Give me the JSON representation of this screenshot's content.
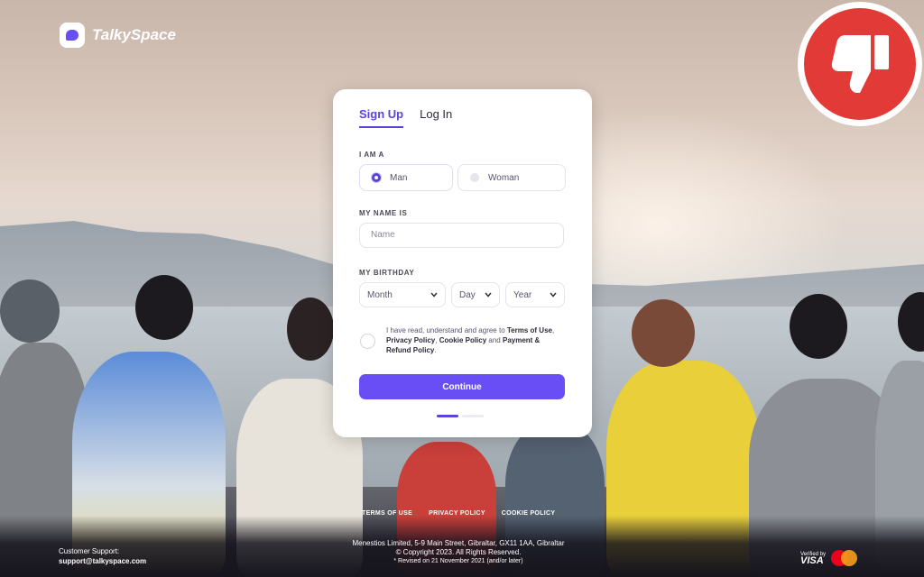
{
  "brand": {
    "name": "TalkySpace"
  },
  "tabs": {
    "signup": "Sign Up",
    "login": "Log In"
  },
  "form": {
    "gender_label": "I AM A",
    "gender_options": {
      "man": "Man",
      "woman": "Woman"
    },
    "selected_gender": "Man",
    "name_label": "MY NAME IS",
    "name_placeholder": "Name",
    "birthday_label": "MY BIRTHDAY",
    "month": "Month",
    "day": "Day",
    "year": "Year",
    "terms": {
      "prefix": "I have read, understand and agree to ",
      "terms_of_use": "Terms of Use",
      "sep1": ", ",
      "privacy": "Privacy Policy",
      "sep2": ", ",
      "cookie": "Cookie Policy",
      "and": " and ",
      "payment": "Payment & Refund Policy",
      "end": "."
    },
    "continue_label": "Continue",
    "progress_step": "1 of 2"
  },
  "footer": {
    "links": {
      "terms": "TERMS OF USE",
      "privacy": "PRIVACY POLICY",
      "cookie": "COOKIE POLICY"
    },
    "support_label": "Customer Support:",
    "support_email": "support@talkyspace.com",
    "address": "Menestios Limited, 5-9 Main Street, Gibraltar, GX11 1AA, Gibraltar",
    "copyright": "© Copyright 2023. All Rights Reserved.",
    "revised": "* Revised on 21 November 2021 (and/or later)",
    "verified_by": "Verified by",
    "visa": "VISA"
  },
  "colors": {
    "accent": "#6a4ef5",
    "badge_red": "#e23b37"
  },
  "icons": {
    "badge": "thumbs-down-icon",
    "logo": "chat-bubble-icon",
    "select": "chevron-down-icon"
  }
}
